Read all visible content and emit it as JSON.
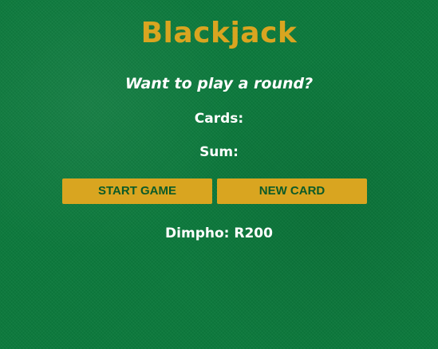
{
  "app": {
    "title": "Blackjack"
  },
  "game": {
    "message": "Want to play a round?",
    "cards_label": "Cards:",
    "sum_label": "Sum:"
  },
  "buttons": {
    "start_label": "START GAME",
    "new_card_label": "NEW CARD"
  },
  "player": {
    "display": "Dimpho: R200"
  },
  "colors": {
    "felt_green": "#0b7a3c",
    "gold_accent": "#d9a520",
    "button_text": "#0a5a28",
    "text": "#ffffff"
  }
}
